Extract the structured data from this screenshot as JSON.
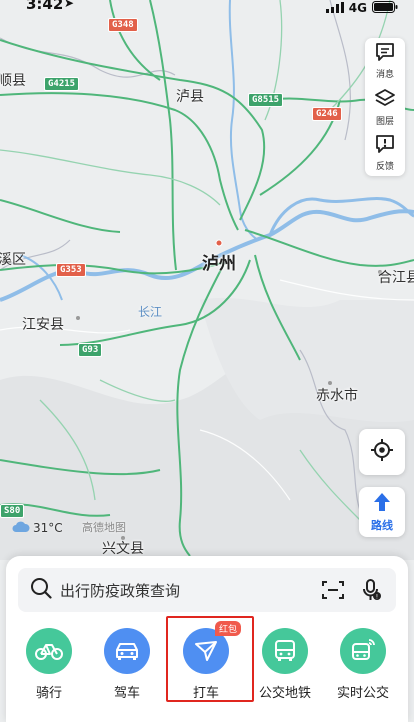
{
  "status_bar": {
    "time": "3:42",
    "network": "4G"
  },
  "map": {
    "places": [
      {
        "name": "泸州",
        "kind": "city"
      },
      {
        "name": "泸县",
        "kind": "county"
      },
      {
        "name": "合江县",
        "kind": "county"
      },
      {
        "name": "江安县",
        "kind": "county"
      },
      {
        "name": "赤水市",
        "kind": "county"
      },
      {
        "name": "兴文县",
        "kind": "county"
      },
      {
        "name": "顺县",
        "kind": "county"
      },
      {
        "name": "溪区",
        "kind": "county"
      }
    ],
    "river_label": "长江",
    "road_shields": [
      "G348",
      "G4215",
      "G8515",
      "G246",
      "G353",
      "G93",
      "S80"
    ]
  },
  "toolbar": {
    "message_label": "消息",
    "layers_label": "图层",
    "feedback_label": "反馈"
  },
  "route_label": "路线",
  "weather": {
    "temperature": "31°C"
  },
  "watermark": "高德地图",
  "search": {
    "placeholder": "出行防疫政策查询"
  },
  "quick_actions": [
    {
      "label": "骑行",
      "color": "#45c89a",
      "icon": "bicycle-icon"
    },
    {
      "label": "驾车",
      "color": "#4f8ff2",
      "icon": "car-icon"
    },
    {
      "label": "打车",
      "color": "#4f8ff2",
      "icon": "taxi-icon",
      "badge": "红包"
    },
    {
      "label": "公交地铁",
      "color": "#45c89a",
      "icon": "bus-icon"
    },
    {
      "label": "实时公交",
      "color": "#45c89a",
      "icon": "realtime-bus-icon"
    }
  ]
}
